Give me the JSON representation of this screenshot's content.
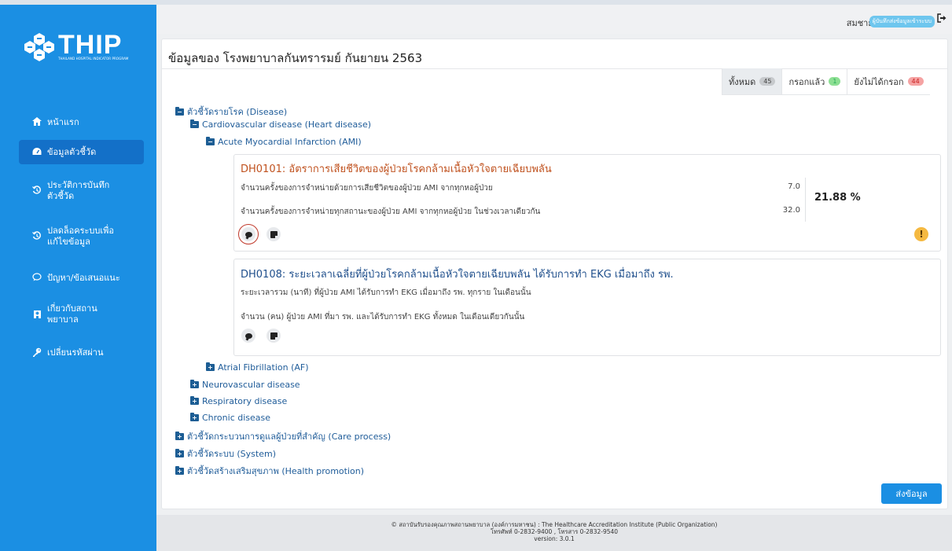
{
  "brand": {
    "logo_text": "THIP",
    "logo_subtitle": "THAILAND HOSPITAL INDICATOR PROGRAM"
  },
  "sidebar": {
    "items": [
      {
        "label": "หน้าแรก",
        "icon": "home-icon"
      },
      {
        "label": "ข้อมูลตัวชี้วัด",
        "icon": "dashboard-icon"
      },
      {
        "label": "ประวัติการบันทึก\nตัวชี้วัด",
        "icon": "history-icon"
      },
      {
        "label": "ปลดล็อคระบบเพื่อ\nแก้ไขข้อมูล",
        "icon": "history-icon"
      },
      {
        "label": "ปัญหา/ข้อเสนอแนะ",
        "icon": "chat-icon"
      },
      {
        "label": "เกี่ยวกับสถาน\nพยาบาล",
        "icon": "hospital-icon"
      },
      {
        "label": "เปลี่ยนรหัสผ่าน",
        "icon": "key-icon"
      }
    ]
  },
  "topbar": {
    "user_name": "สมชาย ทดสอบ",
    "role": "ผู้บันทึกส่งข้อมูลเข้าระบบ"
  },
  "page": {
    "title": "ข้อมูลของ โรงพยาบาลกันทรารมย์ กันยายน 2563"
  },
  "filters": [
    {
      "label": "ทั้งหมด",
      "count": "45"
    },
    {
      "label": "กรอกแล้ว",
      "count": "1"
    },
    {
      "label": "ยังไม่ได้กรอก",
      "count": "44"
    }
  ],
  "tree": {
    "disease": "ตัวชี้วัดรายโรค (Disease)",
    "cardio": "Cardiovascular disease (Heart disease)",
    "ami": "Acute Myocardial Infarction (AMI)",
    "af": "Atrial Fibrillation (AF)",
    "neuro": "Neurovascular disease",
    "resp": "Respiratory disease",
    "chronic": "Chronic disease",
    "care": "ตัวชี้วัดกระบวนการดูแลผู้ป่วยที่สำคัญ (Care process)",
    "system": "ตัวชี้วัดระบบ (System)",
    "health": "ตัวชี้วัดสร้างเสริมสุขภาพ (Health promotion)"
  },
  "indicators": [
    {
      "title": "DH0101: อัตราการเสียชีวิตของผู้ป่วยโรคกล้ามเนื้อหัวใจตายเฉียบพลัน",
      "title_color": "#c0521f",
      "numerator_label": "จำนวนครั้งของการจำหน่ายด้วยการเสียชีวิตของผู้ป่วย AMI จากทุกหอผู้ป่วย",
      "numerator_value": "7.0",
      "denominator_label": "จำนวนครั้งของการจำหน่ายทุกสถานะของผู้ป่วย AMI จากทุกหอผู้ป่วย ในช่วงเวลาเดียวกัน",
      "denominator_value": "32.0",
      "result": "21.88 %"
    },
    {
      "title": "DH0108: ระยะเวลาเฉลี่ยที่ผู้ป่วยโรคกล้ามเนื้อหัวใจตายเฉียบพลัน ได้รับการทำ EKG เมื่อมาถึง รพ.",
      "title_color": "#1f4f8c",
      "numerator_label": "ระยะเวลารวม (นาที) ที่ผู้ป่วย AMI ได้รับการทำ EKG เมื่อมาถึง รพ. ทุกราย ในเดือนนั้น",
      "denominator_label": "จำนวน (คน) ผู้ป่วย AMI ที่มา รพ. และได้รับการทำ EKG ทั้งหมด ในเดือนเดียวกันนั้น"
    }
  ],
  "actions": {
    "submit": "ส่งข้อมูล"
  },
  "footer": {
    "line1": "© สถาบันรับรองคุณภาพสถานพยาบาล (องค์การมหาชน) : The Healthcare Accreditation Institute (Public Organization)",
    "line2": "โทรศัพท์ 0-2832-9400 , โทรสาร 0-2832-9540",
    "line3": "version: 3.0.1"
  },
  "colors": {
    "sidebar": "#1b8fe3",
    "sidebar_active": "#1370c8",
    "folder": "#1c5d94",
    "link": "#1f5c99"
  }
}
